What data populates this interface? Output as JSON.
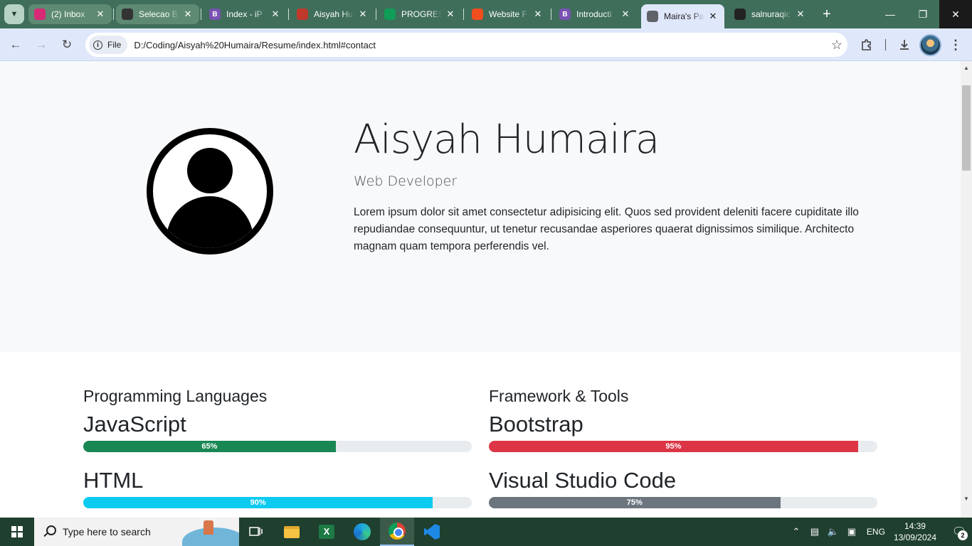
{
  "browser": {
    "tabs": [
      {
        "title": "(2) Inbox",
        "favicon": "instagram-icon",
        "color": "#d62976"
      },
      {
        "title": "Selecao B",
        "favicon": "github-icon",
        "color": "#333333"
      },
      {
        "title": "Index - iP",
        "favicon": "bootstrap-icon",
        "color": "#7952b3",
        "glyph": "B"
      },
      {
        "title": "Aisyah Hu",
        "favicon": "git-repo-icon",
        "color": "#c0392b"
      },
      {
        "title": "PROGRES",
        "favicon": "google-sheets-icon",
        "color": "#0f9d58"
      },
      {
        "title": "Website F",
        "favicon": "figma-icon",
        "color": "#f24e1e"
      },
      {
        "title": "Introducti",
        "favicon": "bootstrap-icon",
        "color": "#7952b3",
        "glyph": "B"
      },
      {
        "title": "Maira's Pa",
        "favicon": "globe-icon",
        "color": "#5f6368",
        "active": true
      },
      {
        "title": "salnuraqic",
        "favicon": "vercel-icon",
        "color": "#222222"
      }
    ],
    "close_glyph": "✕",
    "new_tab_glyph": "+",
    "address": {
      "scheme_label": "File",
      "url": "D:/Coding/Aisyah%20Humaira/Resume/index.html#contact"
    }
  },
  "hero": {
    "name": "Aisyah Humaira",
    "role": "Web Developer",
    "bio": "Lorem ipsum dolor sit amet consectetur adipisicing elit. Quos sed provident deleniti facere cupiditate illo repudiandae consequuntur, ut tenetur recusandae asperiores quaerat dignissimos similique. Architecto magnam quam tempora perferendis vel."
  },
  "skills": {
    "left": {
      "heading": "Programming Languages",
      "items": [
        {
          "name": "JavaScript",
          "percent": 65,
          "label": "65%",
          "color": "#198754"
        },
        {
          "name": "HTML",
          "percent": 90,
          "label": "90%",
          "color": "#0dcaf0"
        }
      ]
    },
    "right": {
      "heading": "Framework & Tools",
      "items": [
        {
          "name": "Bootstrap",
          "percent": 95,
          "label": "95%",
          "color": "#dc3545"
        },
        {
          "name": "Visual Studio Code",
          "percent": 75,
          "label": "75%",
          "color": "#6c757d"
        }
      ]
    }
  },
  "taskbar": {
    "search_placeholder": "Type here to search",
    "apps": [
      "task-view-icon",
      "file-explorer-icon",
      "excel-icon",
      "edge-icon",
      "chrome-icon",
      "vscode-icon"
    ],
    "excel_glyph": "X",
    "language": "ENG",
    "time": "14:39",
    "date": "13/09/2024",
    "notification_count": "2"
  }
}
